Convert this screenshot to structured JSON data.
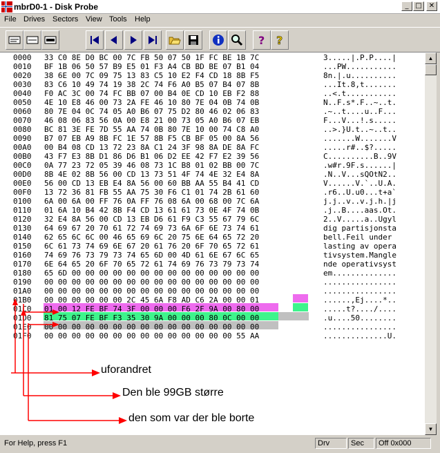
{
  "window": {
    "title": "mbrD0-1 - Disk Probe"
  },
  "menu": [
    "File",
    "Drives",
    "Sectors",
    "View",
    "Tools",
    "Help"
  ],
  "toolbar_icons": [
    "sector-view-icon",
    "sector-view-alt-icon",
    "sector-list-icon",
    "first-icon",
    "previous-icon",
    "next-icon",
    "last-icon",
    "open-icon",
    "save-icon",
    "info-icon",
    "search-icon",
    "help-icon",
    "context-help-icon"
  ],
  "hex_rows": [
    {
      "addr": "0000",
      "hex": "33 C0 8E D0 BC 00 7C FB 50 07 50 1F FC BE 1B 7C",
      "ascii": "3.....|.P.P....|"
    },
    {
      "addr": "0010",
      "hex": "BF 1B 06 50 57 B9 E5 01 F3 A4 CB BD BE 07 B1 04",
      "ascii": "...PW..........."
    },
    {
      "addr": "0020",
      "hex": "38 6E 00 7C 09 75 13 83 C5 10 E2 F4 CD 18 8B F5",
      "ascii": "8n.|.u.........."
    },
    {
      "addr": "0030",
      "hex": "83 C6 10 49 74 19 38 2C 74 F6 A0 B5 07 B4 07 8B",
      "ascii": "...It.8,t......."
    },
    {
      "addr": "0040",
      "hex": "F0 AC 3C 00 74 FC BB 07 00 B4 0E CD 10 EB F2 88",
      "ascii": "..<.t..........."
    },
    {
      "addr": "0050",
      "hex": "4E 10 E8 46 00 73 2A FE 46 10 80 7E 04 0B 74 0B",
      "ascii": "N..F.s*.F..~..t."
    },
    {
      "addr": "0060",
      "hex": "80 7E 04 0C 74 05 A0 B6 07 75 D2 80 46 02 06 83",
      "ascii": ".~..t....u..F..."
    },
    {
      "addr": "0070",
      "hex": "46 08 06 83 56 0A 00 E8 21 00 73 05 A0 B6 07 EB",
      "ascii": "F...V...!.s....."
    },
    {
      "addr": "0080",
      "hex": "BC 81 3E FE 7D 55 AA 74 0B 80 7E 10 00 74 C8 A0",
      "ascii": "..>.}U.t..~..t.."
    },
    {
      "addr": "0090",
      "hex": "B7 07 EB A9 8B FC 1E 57 8B F5 CB BF 05 00 8A 56",
      "ascii": ".......W.......V"
    },
    {
      "addr": "00A0",
      "hex": "00 B4 08 CD 13 72 23 8A C1 24 3F 98 8A DE 8A FC",
      "ascii": ".....r#..$?....."
    },
    {
      "addr": "00B0",
      "hex": "43 F7 E3 8B D1 86 D6 B1 06 D2 EE 42 F7 E2 39 56",
      "ascii": "C..........B..9V"
    },
    {
      "addr": "00C0",
      "hex": "0A 77 23 72 05 39 46 08 73 1C B8 01 02 BB 00 7C",
      "ascii": ".w#r.9F.s......|"
    },
    {
      "addr": "00D0",
      "hex": "8B 4E 02 8B 56 00 CD 13 73 51 4F 74 4E 32 E4 8A",
      "ascii": ".N..V...sQOtN2.."
    },
    {
      "addr": "00E0",
      "hex": "56 00 CD 13 EB E4 8A 56 00 60 BB AA 55 B4 41 CD",
      "ascii": "V......V.`..U.A."
    },
    {
      "addr": "00F0",
      "hex": "13 72 36 81 FB 55 AA 75 30 F6 C1 01 74 2B 61 60",
      "ascii": ".r6..U.u0...t+a`"
    },
    {
      "addr": "0100",
      "hex": "6A 00 6A 00 FF 76 0A FF 76 08 6A 00 68 00 7C 6A",
      "ascii": "j.j..v..v.j.h.|j"
    },
    {
      "addr": "0110",
      "hex": "01 6A 10 B4 42 8B F4 CD 13 61 61 73 0E 4F 74 0B",
      "ascii": ".j..B....aas.Ot."
    },
    {
      "addr": "0120",
      "hex": "32 E4 8A 56 00 CD 13 EB D6 61 F9 C3 55 67 79 6C",
      "ascii": "2..V.....a..Ugyl"
    },
    {
      "addr": "0130",
      "hex": "64 69 67 20 70 61 72 74 69 73 6A 6F 6E 73 74 61",
      "ascii": "dig partisjonsta"
    },
    {
      "addr": "0140",
      "hex": "62 65 6C 6C 00 46 65 69 6C 20 75 6E 64 65 72 20",
      "ascii": "bell.Feil under "
    },
    {
      "addr": "0150",
      "hex": "6C 61 73 74 69 6E 67 20 61 76 20 6F 70 65 72 61",
      "ascii": "lasting av opera"
    },
    {
      "addr": "0160",
      "hex": "74 69 76 73 79 73 74 65 6D 00 4D 61 6E 67 6C 65",
      "ascii": "tivsystem.Mangle"
    },
    {
      "addr": "0170",
      "hex": "6E 64 65 20 6F 70 65 72 61 74 69 76 73 79 73 74",
      "ascii": "nde operativsyst"
    },
    {
      "addr": "0180",
      "hex": "65 6D 00 00 00 00 00 00 00 00 00 00 00 00 00 00",
      "ascii": "em.............."
    },
    {
      "addr": "0190",
      "hex": "00 00 00 00 00 00 00 00 00 00 00 00 00 00 00 00",
      "ascii": "................"
    },
    {
      "addr": "01A0",
      "hex": "00 00 00 00 00 00 00 00 00 00 00 00 00 00 00 00",
      "ascii": "................"
    },
    {
      "addr": "01B0",
      "hex": "00 00 00 00 00 00 2C 45 6A F8 AD C6 2A 00 00 01",
      "ascii": "......,Ej....*.."
    },
    {
      "addr": "01C0",
      "hex": "01 00 12 FE BF 74 3F 00 00 00 F6 2F 9A 00 80 00",
      "ascii": ".....t?..../...."
    },
    {
      "addr": "01D0",
      "hex": "81 75 07 FE BF F3 35 30 9A 00 00 00 80 0C 00 00",
      "ascii": ".u....50........"
    },
    {
      "addr": "01E0",
      "hex": "00 00 00 00 00 00 00 00 00 00 00 00 00 00 00 00",
      "ascii": "................"
    },
    {
      "addr": "01F0",
      "hex": "00 00 00 00 00 00 00 00 00 00 00 00 00 00 55 AA",
      "ascii": "..............U."
    }
  ],
  "annotations": [
    "uforandret",
    "Den ble 99GB større",
    "den som var der ble borte"
  ],
  "status": {
    "help": "For Help, press F1",
    "drv": "Drv",
    "sec": "Sec",
    "off": "Off 0x000"
  },
  "colors": {
    "pink": "#ee6bee",
    "green": "#3ef48c",
    "gray": "#c0c0c0",
    "arrow": "#ff0000"
  }
}
